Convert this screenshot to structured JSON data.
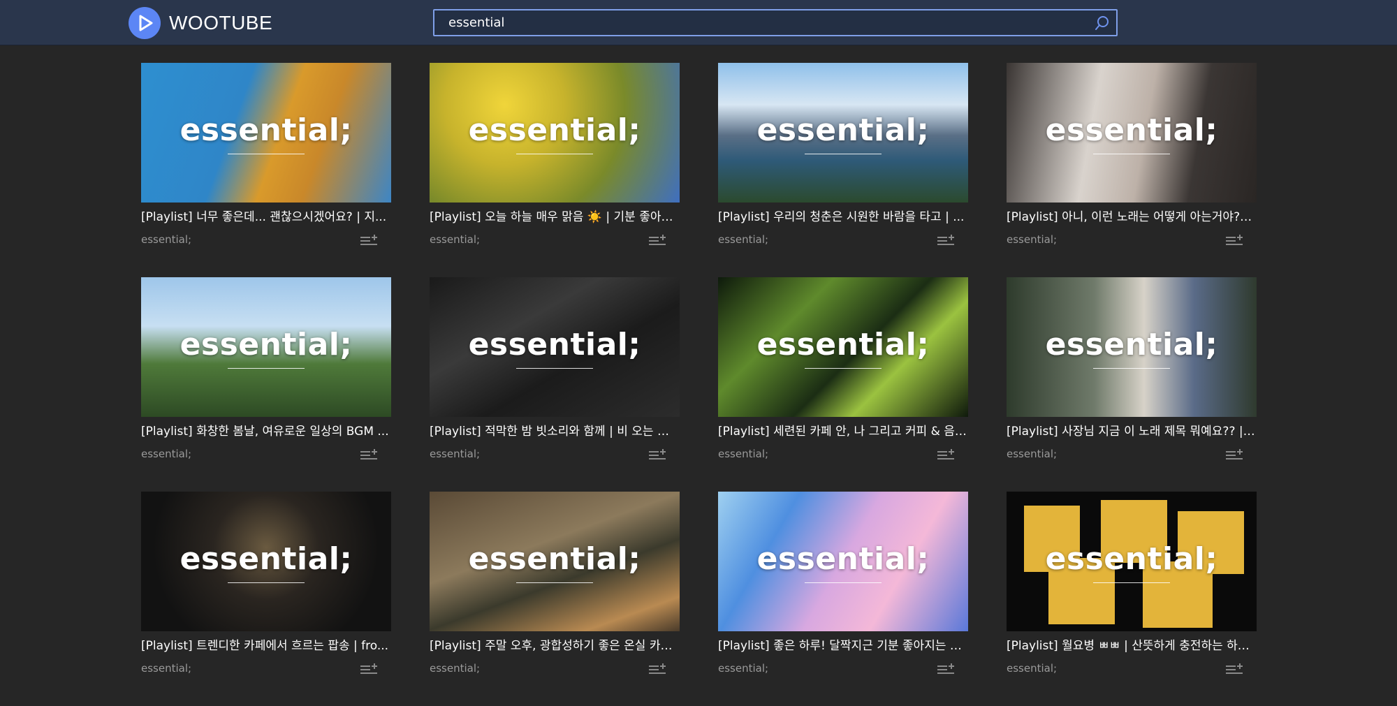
{
  "app": {
    "logo_text": "WOOTUBE",
    "accent_color": "#5c86f5",
    "header_color": "#2a364c"
  },
  "search": {
    "value": "essential",
    "icon": "search-icon"
  },
  "videos": [
    {
      "thumb_text": "essential;",
      "title": "[Playlist] 너무 좋은데... 괜찮으시겠어요? | 지...",
      "channel": "essential;"
    },
    {
      "thumb_text": "essential;",
      "title": "[Playlist] 오늘 하늘 매우 맑음 ☀️ | 기분 좋아지...",
      "channel": "essential;"
    },
    {
      "thumb_text": "essential;",
      "title": "[Playlist] 우리의 청춘은 시원한 바람을 타고 | ...",
      "channel": "essential;"
    },
    {
      "thumb_text": "essential;",
      "title": "[Playlist] 아니, 이런 노래는 어떻게 아는거야?? ...",
      "channel": "essential;"
    },
    {
      "thumb_text": "essential;",
      "title": "[Playlist] 화창한 봄날, 여유로운 일상의 BGM ...",
      "channel": "essential;"
    },
    {
      "thumb_text": "essential;",
      "title": "[Playlist] 적막한 밤 빗소리와 함께 | 비 오는 날, ...",
      "channel": "essential;"
    },
    {
      "thumb_text": "essential;",
      "title": "[Playlist] 세련된 카페 안, 나 그리고 커피 & 음악...",
      "channel": "essential;"
    },
    {
      "thumb_text": "essential;",
      "title": "[Playlist] 사장님 지금 이 노래 제목 뭐예요?? | ...",
      "channel": "essential;"
    },
    {
      "thumb_text": "essential;",
      "title": "[Playlist] 트렌디한 카페에서 흐르는 팝송 | fro...",
      "channel": "essential;"
    },
    {
      "thumb_text": "essential;",
      "title": "[Playlist] 주말 오후, 광합성하기 좋은 온실 카페...",
      "channel": "essential;"
    },
    {
      "thumb_text": "essential;",
      "title": "[Playlist] 좋은 하루! 달짝지근 기분 좋아지는 D...",
      "channel": "essential;"
    },
    {
      "thumb_text": "essential;",
      "title": "[Playlist] 월요병 ㅃㅃ | 산뜻하게 충전하는 하루...",
      "channel": "essential;"
    }
  ],
  "icons": {
    "add_to_playlist": "playlist-add-icon",
    "logo": "play-icon"
  }
}
